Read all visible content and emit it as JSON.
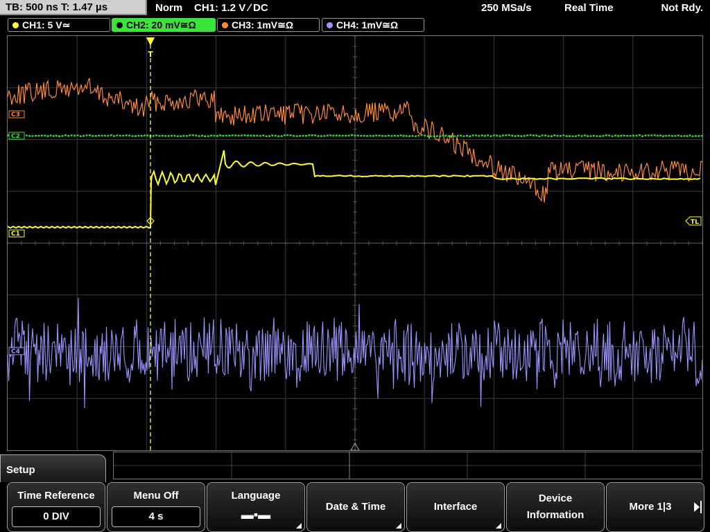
{
  "topbar": {
    "timebase": "TB: 500 ns   T: 1.47 µs",
    "mode": "Norm",
    "trigger": "CH1: 1.2 V ∕ DC",
    "samplerate": "250 MSa/s",
    "acq": "Real Time",
    "status": "Not Rdy."
  },
  "channels": [
    {
      "label": "CH1: 5 V≃",
      "color": "#ffff33"
    },
    {
      "label": "CH2: 20 mV≅Ω",
      "color": "#39e639"
    },
    {
      "label": "CH3: 1mV≅Ω",
      "color": "#ff8c33"
    },
    {
      "label": "CH4: 1mV≅Ω",
      "color": "#9a96ff"
    }
  ],
  "markers": {
    "c3": "C3",
    "c2": "C2",
    "c1": "C1",
    "c4": "C4",
    "tl": "TL",
    "trig": "T"
  },
  "menu": {
    "title": "Setup",
    "softkeys": [
      {
        "label": "Time Reference",
        "value": "0 DIV"
      },
      {
        "label": "Menu Off",
        "value": "4 s"
      },
      {
        "label": "Language",
        "icon": "speech-bubbles-icon"
      },
      {
        "label": "Date & Time"
      },
      {
        "label": "Interface"
      },
      {
        "label": "Device\nInformation"
      },
      {
        "label": "More 1|3"
      }
    ]
  }
}
